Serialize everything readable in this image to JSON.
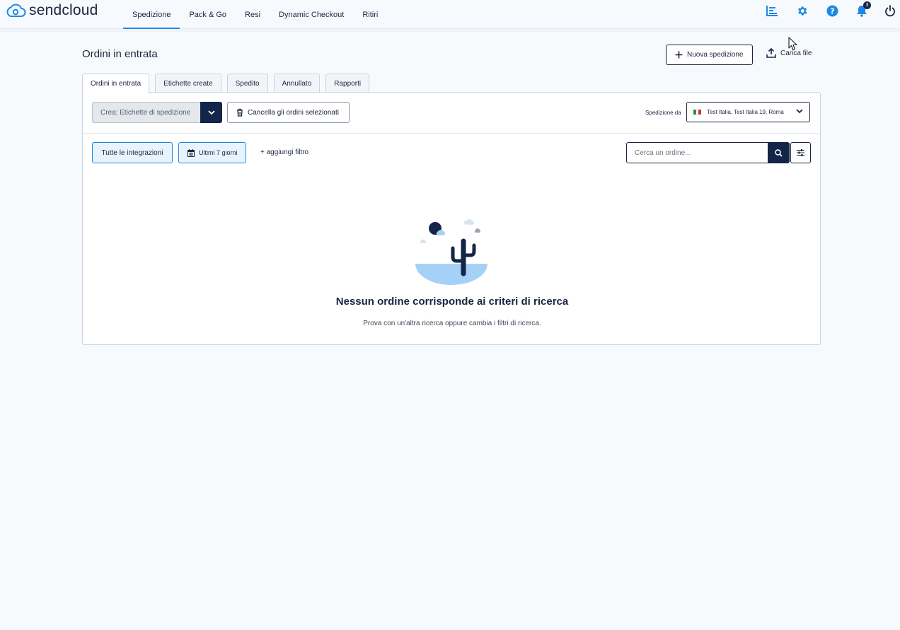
{
  "brand": {
    "name": "sendcloud"
  },
  "nav": {
    "items": [
      {
        "label": "Spedizione",
        "active": true
      },
      {
        "label": "Pack & Go"
      },
      {
        "label": "Resi"
      },
      {
        "label": "Dynamic Checkout"
      },
      {
        "label": "Ritiri"
      }
    ]
  },
  "top_icons": [
    {
      "icon": "analytics-icon"
    },
    {
      "icon": "gear-icon"
    },
    {
      "icon": "help-icon"
    },
    {
      "icon": "bell-icon",
      "badge": "3"
    },
    {
      "icon": "power-icon"
    }
  ],
  "page": {
    "title": "Ordini in entrata",
    "new_shipment_label": "Nuova spedizione",
    "upload_label": "Carica file"
  },
  "tabs": [
    {
      "label": "Ordini in entrata",
      "active": true
    },
    {
      "label": "Etichette create"
    },
    {
      "label": "Spedito"
    },
    {
      "label": "Annullato"
    },
    {
      "label": "Rapporti"
    }
  ],
  "toolbar": {
    "create_label": "Crea: Etichette di spedizione",
    "delete_label": "Cancella gli ordini selezionati",
    "ship_from_label": "Spedizione da",
    "ship_from_value": "Test Italia, Test Italia 19, Roma"
  },
  "filters": {
    "integrations_label": "Tutte le integrazioni",
    "date_label": "Ultimi 7 giorni",
    "add_filter_label": "+ aggiungi filtro",
    "search_placeholder": "Cerca un ordine..."
  },
  "empty_state": {
    "title": "Nessun ordine corrisponde ai criteri di ricerca",
    "subtitle": "Prova con un'altra ricerca oppure cambia i filtri di ricerca."
  },
  "colors": {
    "accent": "#1e88e5",
    "navy": "#14254a",
    "background": "#f7fafd"
  }
}
